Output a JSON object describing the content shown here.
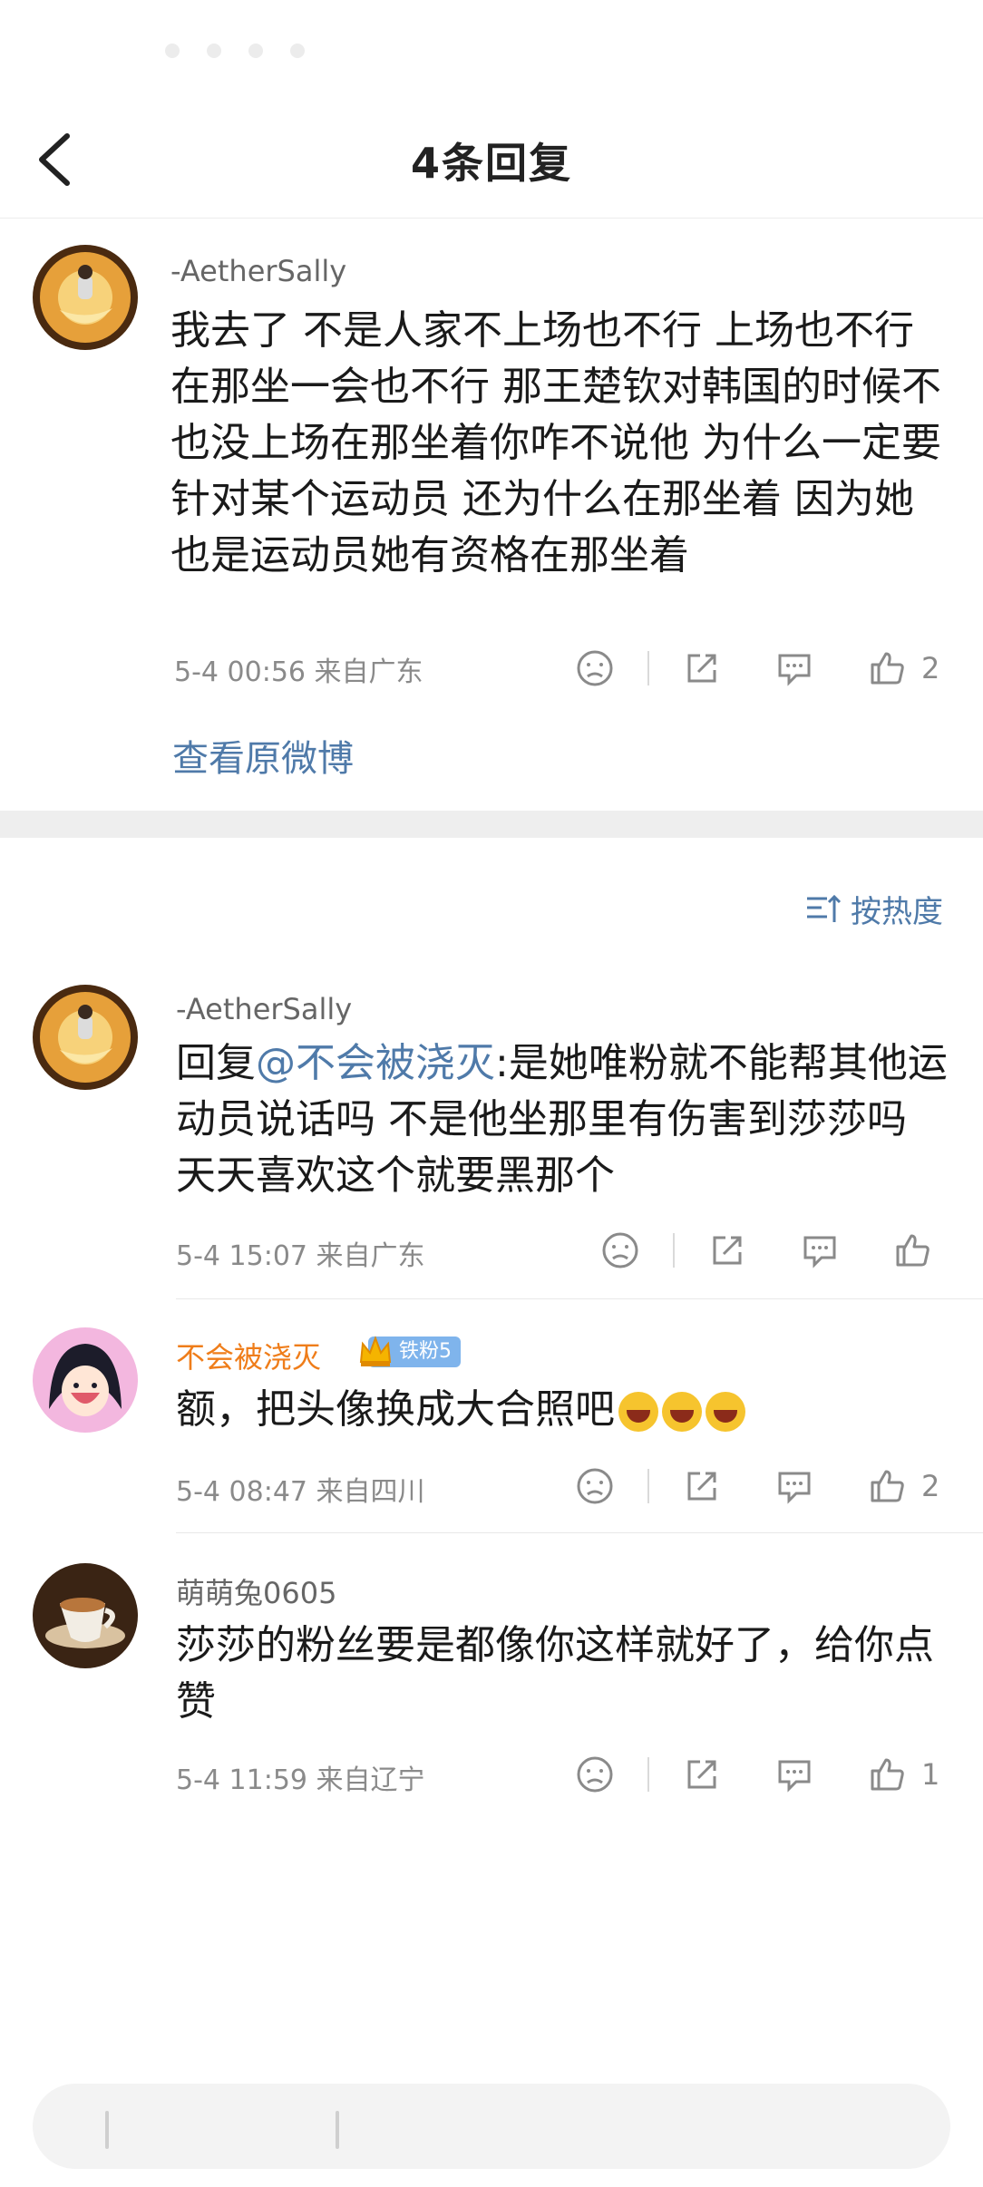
{
  "header": {
    "title": "4条回复"
  },
  "original": {
    "username": "-AetherSally",
    "text": "我去了 不是人家不上场也不行 上场也不行在那坐一会也不行 那王楚钦对韩国的时候不也没上场在那坐着你咋不说他 为什么一定要针对某个运动员 还为什么在那坐着 因为她也是运动员她有资格在那坐着",
    "meta": "5-4 00:56 来自广东",
    "like_count": "2",
    "view_original": "查看原微博"
  },
  "sort": {
    "label": "按热度"
  },
  "replies": [
    {
      "username": "-AetherSally",
      "reply_prefix": "回复",
      "mention": "@不会被浇灭",
      "text": ":是她唯粉就不能帮其他运动员说话吗 不是他坐那里有伤害到莎莎吗 天天喜欢这个就要黑那个",
      "meta": "5-4 15:07 来自广东",
      "like_count": ""
    },
    {
      "username": "不会被浇灭",
      "badge": "铁粉5",
      "text": "额，把头像换成大合照吧",
      "meta": "5-4 08:47 来自四川",
      "like_count": "2"
    },
    {
      "username": "萌萌兔0605",
      "text": "莎莎的粉丝要是都像你这样就好了，给你点赞",
      "meta": "5-4 11:59 来自辽宁",
      "like_count": "1"
    }
  ],
  "colors": {
    "link": "#4f7aa9",
    "vip_name": "#ef7d1a",
    "badge": "#7fb4ec"
  },
  "icons": [
    "back-arrow-icon",
    "dislike-icon",
    "share-icon",
    "comment-icon",
    "like-icon",
    "sort-icon"
  ]
}
